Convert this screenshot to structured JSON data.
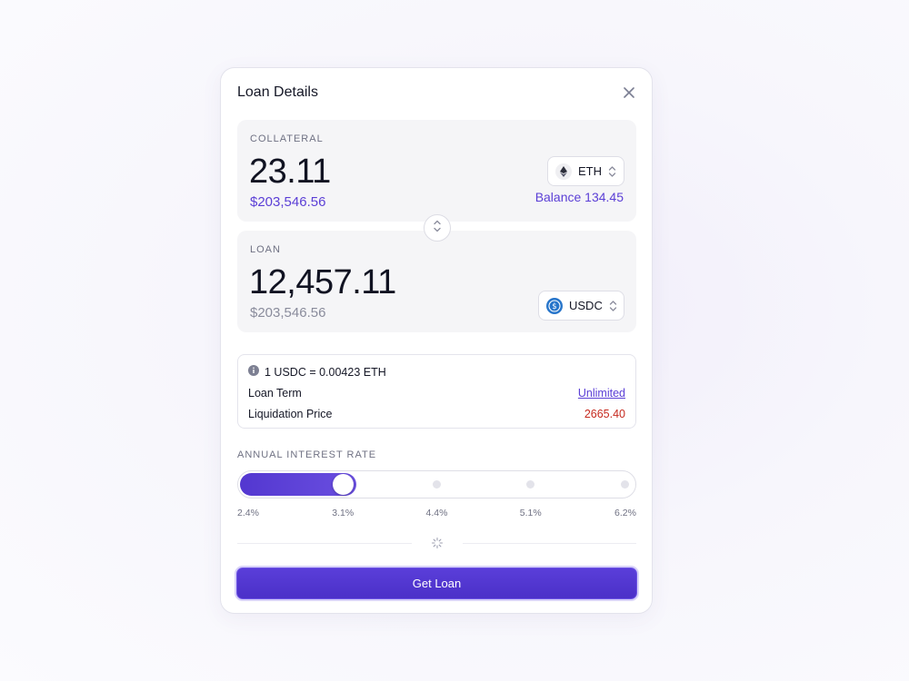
{
  "modal": {
    "title": "Loan Details"
  },
  "collateral": {
    "label": "COLLATERAL",
    "amount": "23.11",
    "usd_value": "$203,546.56",
    "token": "ETH",
    "balance": "Balance 134.45"
  },
  "loan": {
    "label": "LOAN",
    "amount": "12,457.11",
    "usd_value": "$203,546.56",
    "token": "USDC"
  },
  "details": {
    "rate": "1 USDC = 0.00423 ETH",
    "term_label": "Loan Term",
    "term_value": "Unlimited",
    "liquidation_label": "Liquidation Price",
    "liquidation_value": "2665.40"
  },
  "interest": {
    "label": "ANNUAL INTEREST RATE",
    "ticks": [
      "2.4%",
      "3.1%",
      "4.4%",
      "5.1%",
      "6.2%"
    ],
    "selected_value": "3.1%"
  },
  "cta": {
    "label": "Get Loan"
  },
  "colors": {
    "accent": "#5b3fd6",
    "danger": "#c62a1f",
    "usdc_brand": "#2775ca"
  },
  "icons": [
    "close-icon",
    "eth-icon",
    "usdc-icon",
    "chevron-updown-icon",
    "swap-icon",
    "info-icon",
    "spinner-icon"
  ]
}
